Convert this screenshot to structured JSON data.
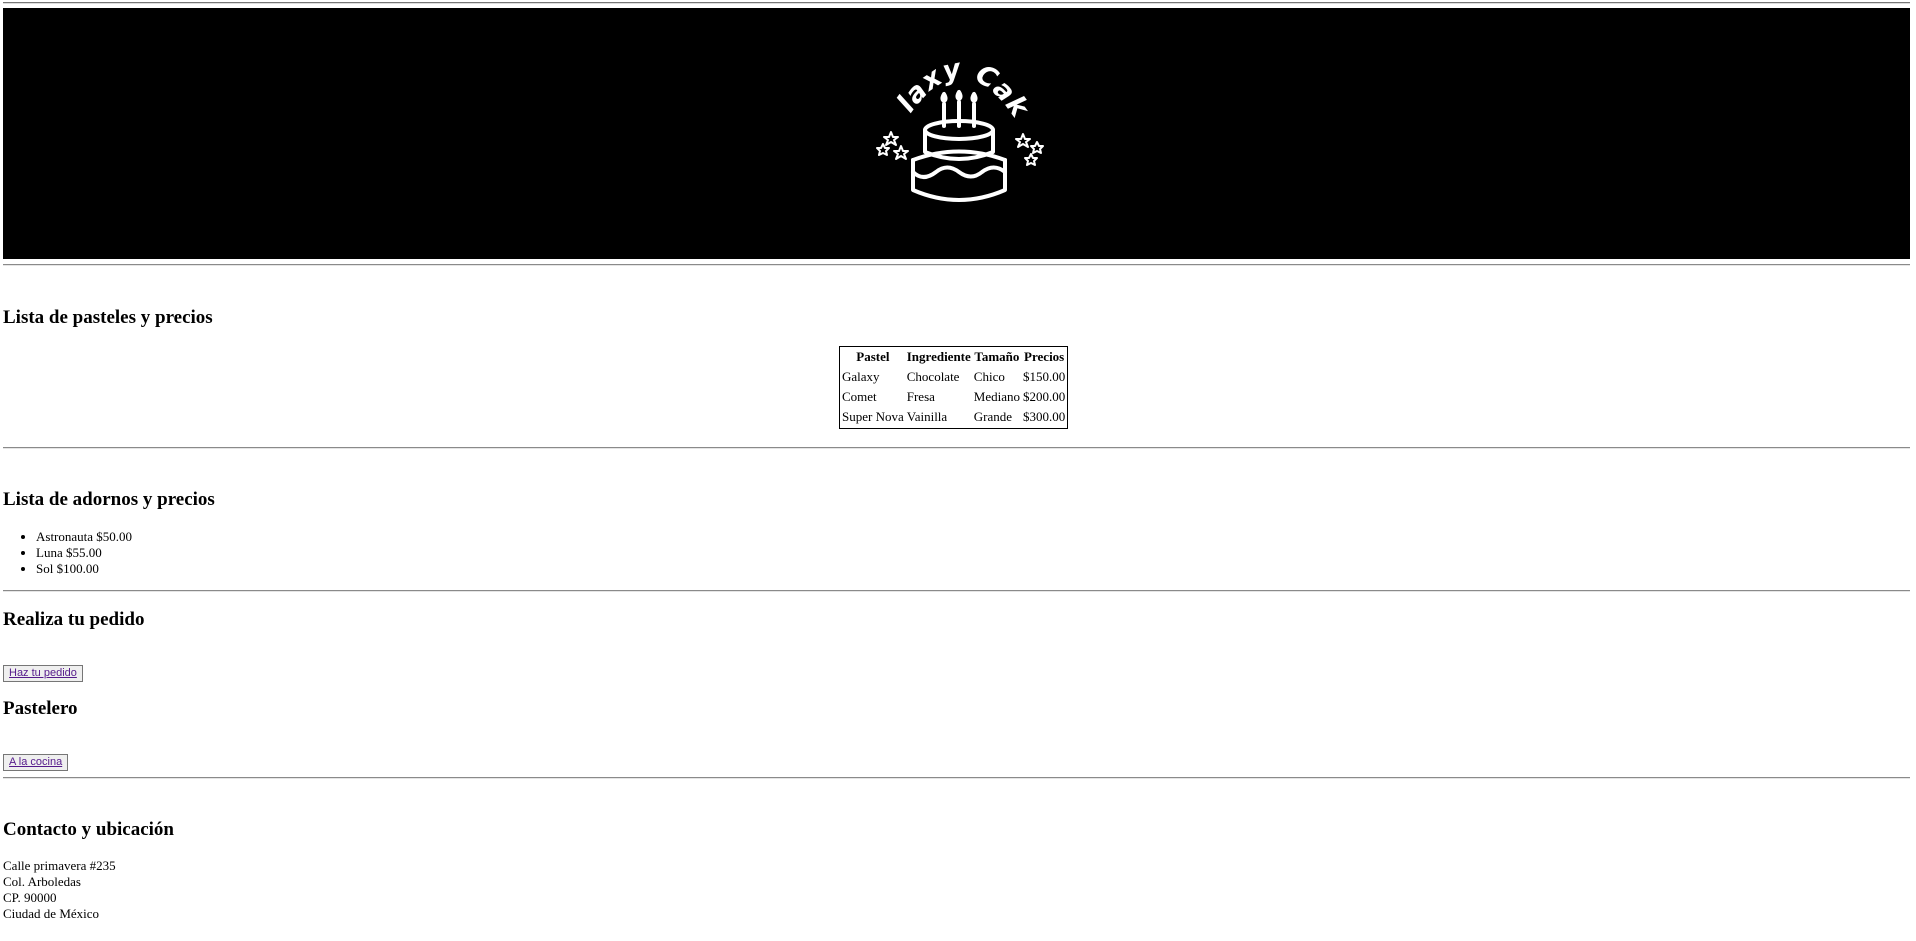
{
  "banner": {
    "logo_text": "Galaxy Cakes",
    "logo_icon": "cake-with-candles-and-stars"
  },
  "cakes_section": {
    "heading": "Lista de pasteles y precios",
    "table": {
      "headers": [
        "Pastel",
        "Ingrediente",
        "Tamaño",
        "Precios"
      ],
      "rows": [
        [
          "Galaxy",
          "Chocolate",
          "Chico",
          "$150.00"
        ],
        [
          "Comet",
          "Fresa",
          "Mediano",
          "$200.00"
        ],
        [
          "Super Nova",
          "Vainilla",
          "Grande",
          "$300.00"
        ]
      ]
    }
  },
  "ornaments_section": {
    "heading": "Lista de adornos y precios",
    "items": [
      "Astronauta $50.00",
      "Luna $55.00",
      "Sol $100.00"
    ]
  },
  "order_section": {
    "heading": "Realiza tu pedido",
    "button_label": "Haz tu pedido"
  },
  "baker_section": {
    "heading": "Pastelero",
    "button_label": "A la cocina"
  },
  "contact_section": {
    "heading": "Contacto y ubicación",
    "address_lines": [
      "Calle primavera #235",
      "Col. Arboledas",
      "CP. 90000",
      "Ciudad de México"
    ]
  }
}
